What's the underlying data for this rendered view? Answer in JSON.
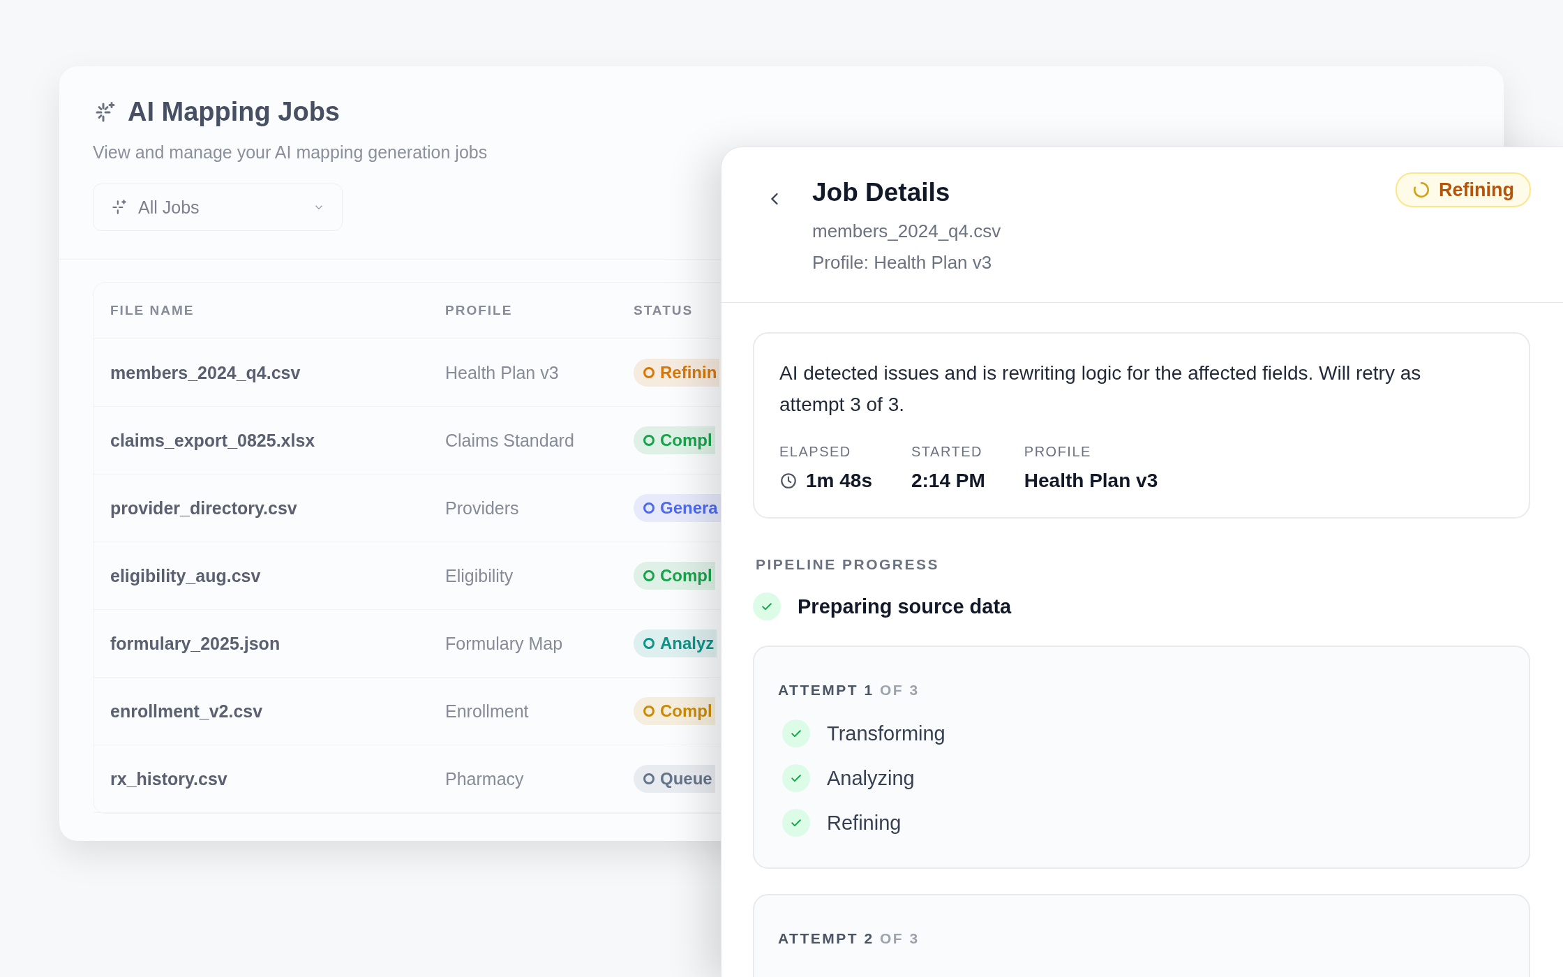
{
  "jobs_page": {
    "title": "AI Mapping Jobs",
    "subtitle": "View and manage your AI mapping generation jobs",
    "filter": {
      "label": "All Jobs"
    },
    "table": {
      "columns": [
        "FILE NAME",
        "PROFILE",
        "STATUS"
      ],
      "rows": [
        {
          "file_name": "members_2024_q4.csv",
          "profile": "Health Plan v3",
          "status": {
            "label": "Refinin",
            "color": "#d97706"
          }
        },
        {
          "file_name": "claims_export_0825.xlsx",
          "profile": "Claims Standard",
          "status": {
            "label": "Compl",
            "color": "#16a34a"
          }
        },
        {
          "file_name": "provider_directory.csv",
          "profile": "Providers",
          "status": {
            "label": "Genera",
            "color": "#4f6bed"
          }
        },
        {
          "file_name": "eligibility_aug.csv",
          "profile": "Eligibility",
          "status": {
            "label": "Compl",
            "color": "#16a34a"
          }
        },
        {
          "file_name": "formulary_2025.json",
          "profile": "Formulary Map",
          "status": {
            "label": "Analyz",
            "color": "#0d9488"
          }
        },
        {
          "file_name": "enrollment_v2.csv",
          "profile": "Enrollment",
          "status": {
            "label": "Compl",
            "color": "#ca8a04"
          }
        },
        {
          "file_name": "rx_history.csv",
          "profile": "Pharmacy",
          "status": {
            "label": "Queue",
            "color": "#64748b"
          }
        }
      ]
    }
  },
  "job_details": {
    "title": "Job Details",
    "file_name": "members_2024_q4.csv",
    "profile": "Profile: Health Plan v3",
    "status_badge": {
      "label": "Refining"
    },
    "summary": {
      "message": "AI detected issues and is rewriting logic for the affected fields. Will retry as attempt 3 of 3.",
      "metrics": [
        {
          "label": "ELAPSED",
          "value": "1m 48s",
          "kind": "duration"
        },
        {
          "label": "STARTED",
          "value": "2:14 PM",
          "kind": "text"
        },
        {
          "label": "PROFILE",
          "value": "Health Plan v3",
          "kind": "text"
        }
      ]
    },
    "pipeline": {
      "heading": "PIPELINE PROGRESS",
      "steps": [
        {
          "label": "Preparing source data",
          "done": true
        }
      ],
      "attempts": [
        {
          "label": "**ATTEMPT 1** OF 3",
          "steps": [
            {
              "label": "Transforming",
              "done": true
            },
            {
              "label": "Analyzing",
              "done": true
            },
            {
              "label": "Refining",
              "done": true
            }
          ]
        },
        {
          "label": "**ATTEMPT 2** OF 3"
        }
      ]
    }
  }
}
